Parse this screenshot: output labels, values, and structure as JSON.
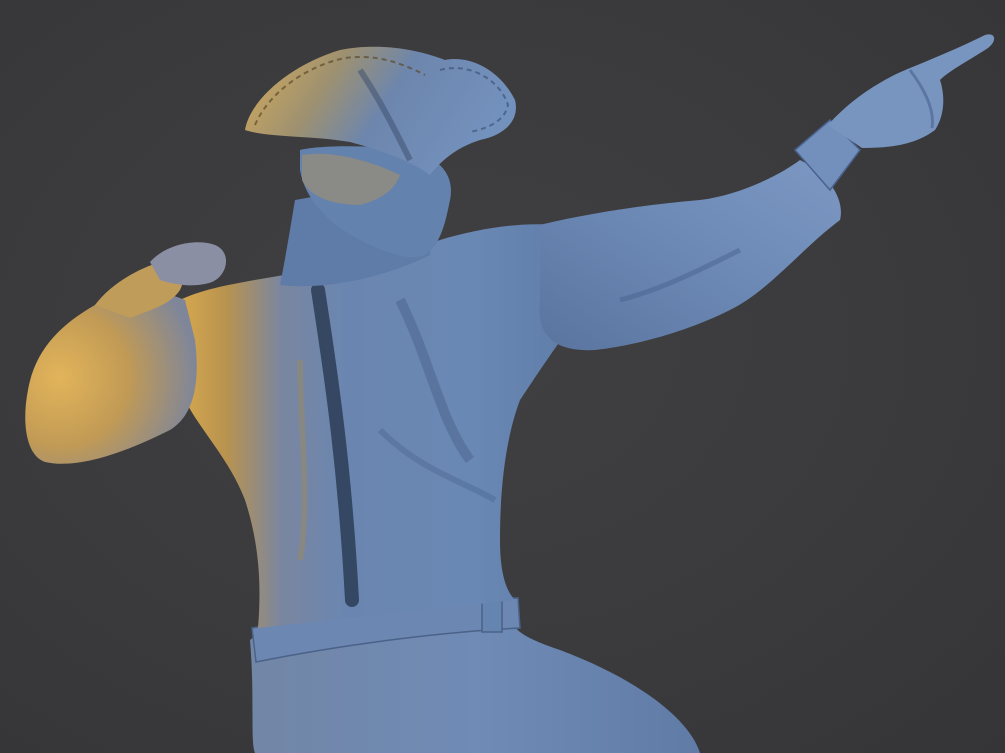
{
  "scene": {
    "subject": "sculpt-render-figure",
    "background_color": "#3b3b3d",
    "material_color": "#6f8db8",
    "material_shadow_color": "#3e5478",
    "key_light_color": "#e0b25a"
  }
}
